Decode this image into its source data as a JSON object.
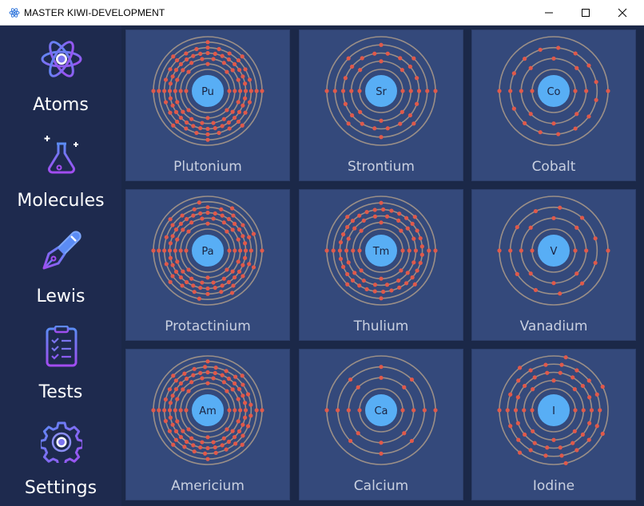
{
  "window": {
    "title": "MASTER KIWI-DEVELOPMENT",
    "minimize_icon": "minimize-icon",
    "maximize_icon": "maximize-icon",
    "close_icon": "close-icon"
  },
  "sidebar": {
    "items": [
      {
        "label": "Atoms",
        "icon": "atom-icon"
      },
      {
        "label": "Molecules",
        "icon": "flask-icon"
      },
      {
        "label": "Lewis",
        "icon": "pen-icon"
      },
      {
        "label": "Tests",
        "icon": "clipboard-icon"
      },
      {
        "label": "Settings",
        "icon": "gear-icon"
      }
    ]
  },
  "atoms": [
    {
      "symbol": "Pu",
      "name": "Plutonium",
      "shells": [
        2,
        8,
        18,
        32,
        24,
        8,
        2
      ]
    },
    {
      "symbol": "Sr",
      "name": "Strontium",
      "shells": [
        2,
        8,
        18,
        8,
        2
      ]
    },
    {
      "symbol": "Co",
      "name": "Cobalt",
      "shells": [
        2,
        8,
        15,
        2
      ]
    },
    {
      "symbol": "Pa",
      "name": "Protactinium",
      "shells": [
        2,
        8,
        18,
        32,
        20,
        9,
        2
      ]
    },
    {
      "symbol": "Tm",
      "name": "Thulium",
      "shells": [
        2,
        8,
        18,
        31,
        8,
        2
      ]
    },
    {
      "symbol": "V",
      "name": "Vanadium",
      "shells": [
        2,
        8,
        11,
        2
      ]
    },
    {
      "symbol": "Am",
      "name": "Americium",
      "shells": [
        2,
        8,
        18,
        32,
        25,
        8,
        2
      ]
    },
    {
      "symbol": "Ca",
      "name": "Calcium",
      "shells": [
        2,
        8,
        8,
        2
      ]
    },
    {
      "symbol": "I",
      "name": "Iodine",
      "shells": [
        2,
        8,
        18,
        18,
        7
      ]
    }
  ],
  "colors": {
    "electron": "#e0594a",
    "orbit": "#9b8f87",
    "nucleus": "#58aef5",
    "nucleus_text": "#1a2340",
    "accent_purple": "#8b5cf6",
    "accent_blue": "#5b8cf5"
  }
}
